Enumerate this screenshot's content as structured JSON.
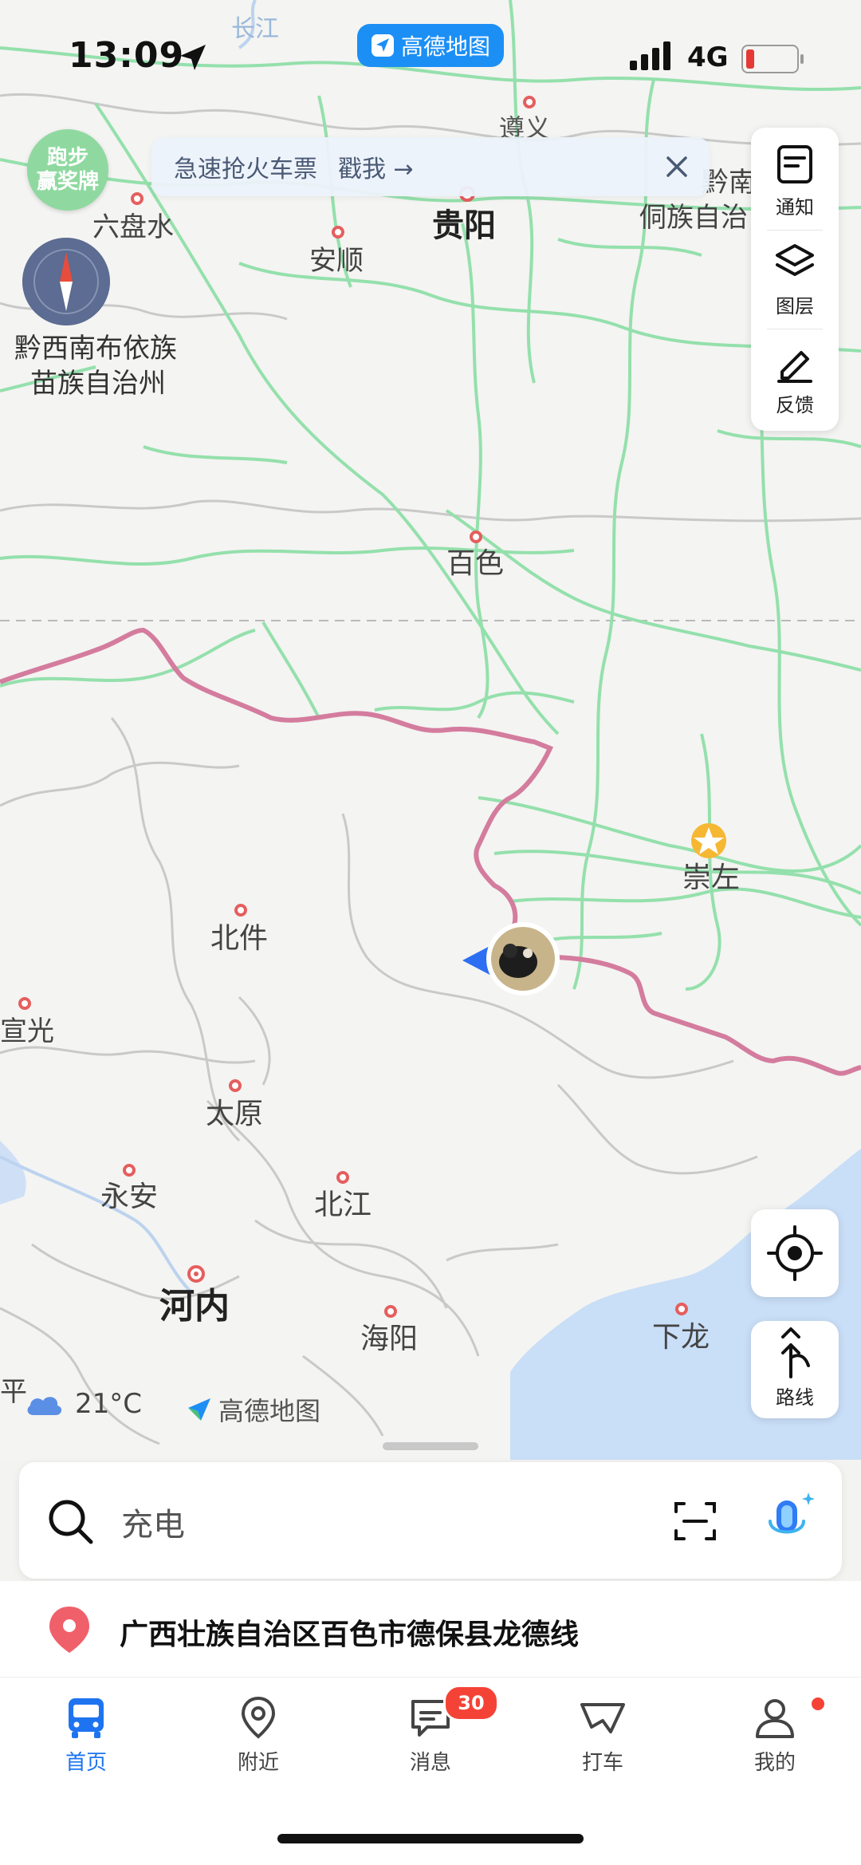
{
  "status_bar": {
    "time": "13:09",
    "app_pill": "高德地图",
    "network": "4G",
    "battery_level": 0.15
  },
  "map": {
    "labels": [
      {
        "id": "changjiang",
        "text": "长江"
      },
      {
        "id": "zunyi",
        "text": "遵义"
      },
      {
        "id": "liupanshui",
        "text": "六盘水"
      },
      {
        "id": "guiyang",
        "text": "贵阳"
      },
      {
        "id": "anshun",
        "text": "安顺"
      },
      {
        "id": "qiannan",
        "text": "黔南苗"
      },
      {
        "id": "dongzu",
        "text": "侗族自治"
      },
      {
        "id": "qianxinan1",
        "text": "黔西南布依族"
      },
      {
        "id": "qianxinan2",
        "text": "苗族自治州"
      },
      {
        "id": "baise",
        "text": "百色"
      },
      {
        "id": "chongzuo",
        "text": "崇左"
      },
      {
        "id": "beijian",
        "text": "北件"
      },
      {
        "id": "xuanguang",
        "text": "宣光"
      },
      {
        "id": "taiyuan",
        "text": "太原"
      },
      {
        "id": "yongan",
        "text": "永安"
      },
      {
        "id": "beijiang",
        "text": "北江"
      },
      {
        "id": "hanoi",
        "text": "河内"
      },
      {
        "id": "haiyang",
        "text": "海阳"
      },
      {
        "id": "xialong",
        "text": "下龙"
      },
      {
        "id": "ping",
        "text": "平"
      }
    ],
    "promo_badge": [
      "跑步",
      "赢奖牌"
    ],
    "banner": {
      "text": "急速抢火车票",
      "link": "戳我 →"
    },
    "side_panel": [
      {
        "label": "通知",
        "icon": "notification-icon"
      },
      {
        "label": "图层",
        "icon": "layers-icon"
      },
      {
        "label": "反馈",
        "icon": "edit-icon"
      }
    ],
    "route_button": "路线",
    "weather": {
      "temp": "21°C",
      "icon": "cloud-icon"
    },
    "logo": "高德地图"
  },
  "search": {
    "placeholder": "充电"
  },
  "location_text": "广西壮族自治区百色市德保县龙德线",
  "tabs": [
    {
      "label": "首页",
      "icon": "bus-icon",
      "active": true
    },
    {
      "label": "附近",
      "icon": "location-pin-icon",
      "active": false
    },
    {
      "label": "消息",
      "icon": "message-icon",
      "active": false
    },
    {
      "label": "打车",
      "icon": "taxi-icon",
      "active": false
    },
    {
      "label": "我的",
      "icon": "user-icon",
      "active": false
    }
  ],
  "messages_badge": "30",
  "colors": {
    "accent": "#1e74f0",
    "road": "#8edca6",
    "border": "#d37c9c",
    "sea": "#c6dcf6"
  }
}
